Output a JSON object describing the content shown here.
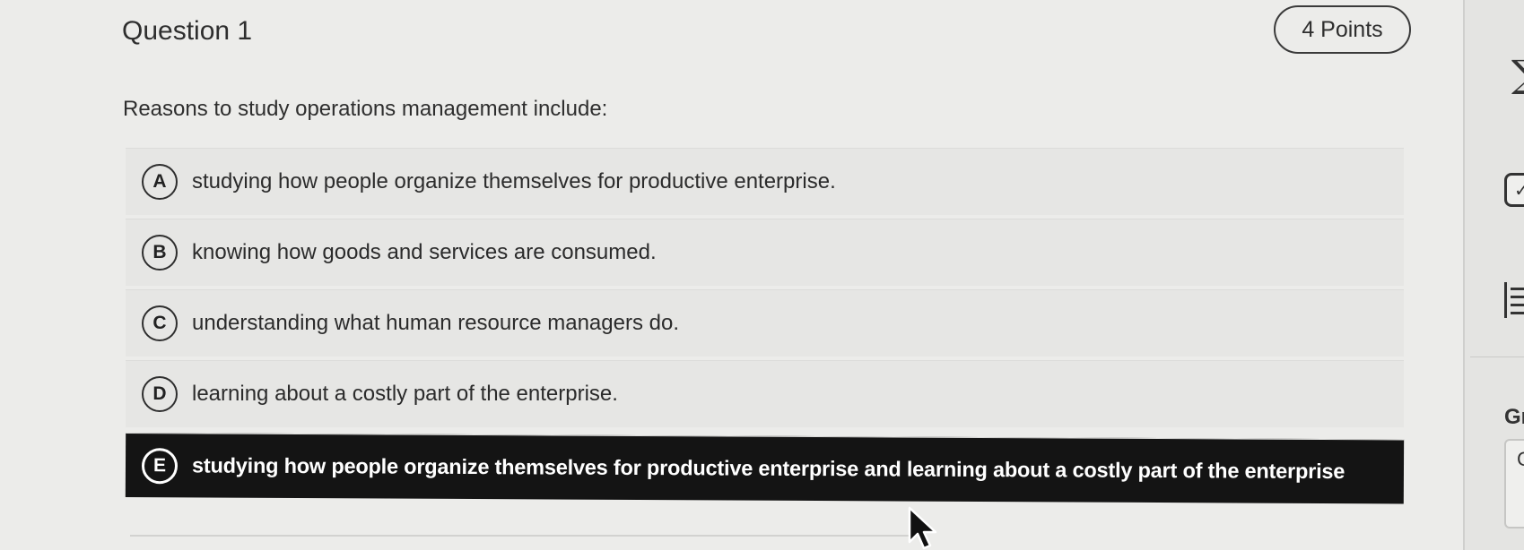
{
  "question": {
    "title": "Question 1",
    "points": "4 Points",
    "prompt": "Reasons to study operations management include:"
  },
  "choices": [
    {
      "letter": "A",
      "text": "studying how people organize themselves for productive enterprise.",
      "selected": false
    },
    {
      "letter": "B",
      "text": "knowing how goods and services are consumed.",
      "selected": false
    },
    {
      "letter": "C",
      "text": "understanding what human resource managers do.",
      "selected": false
    },
    {
      "letter": "D",
      "text": "learning about a costly part of the enterprise.",
      "selected": false
    },
    {
      "letter": "E",
      "text": "studying how people organize themselves for productive enterprise and learning about a costly part of the enterprise",
      "selected": true
    }
  ],
  "right_panel": {
    "gr_label": "Gr",
    "box_char": "C",
    "icons": [
      "sigma-icon",
      "checkbox-icon",
      "document-icon"
    ]
  },
  "colors": {
    "selected_bg": "#141414",
    "choice_bg": "#e6e6e4",
    "page_bg": "#ececea"
  }
}
